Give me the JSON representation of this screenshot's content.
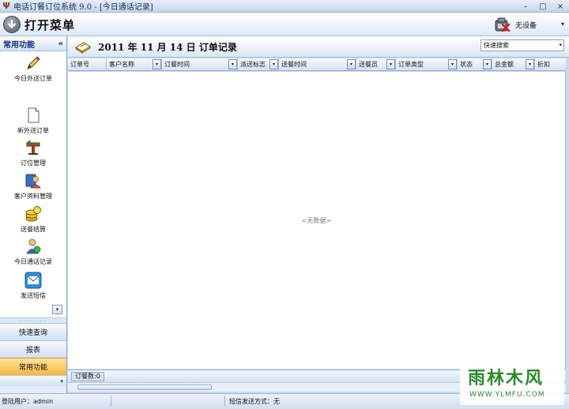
{
  "window": {
    "title": "电话订餐订位系统 9.0 - [今日通话记录]",
    "controls": [
      "–",
      "□",
      "×"
    ]
  },
  "header": {
    "open_menu_label": "打开菜单",
    "device_label": "无设备",
    "dropdown_glyph": "▾"
  },
  "sidebar": {
    "title": "常用功能",
    "collapse_glyph": "«",
    "items": [
      {
        "label": "今日外送订单",
        "icon": "pen-icon"
      },
      {
        "label": "新外送订单",
        "icon": "new-document-icon"
      },
      {
        "label": "订位管理",
        "icon": "table-reservation-icon"
      },
      {
        "label": "客户资料管理",
        "icon": "customers-icon"
      },
      {
        "label": "送餐结算",
        "icon": "coins-icon"
      },
      {
        "label": "今日通话记录",
        "icon": "phone-call-icon"
      },
      {
        "label": "发送短信",
        "icon": "mail-icon"
      }
    ],
    "scroll_glyph": "▾",
    "grip": "............",
    "tabs": [
      {
        "label": "快速查询",
        "active": false
      },
      {
        "label": "报表",
        "active": false
      },
      {
        "label": "常用功能",
        "active": true
      }
    ],
    "more_glyph": "▾"
  },
  "main": {
    "title": "2011 年 11 月 14 日 订单记录",
    "quick_search": {
      "value": "快速搜索",
      "arrow": "▾"
    },
    "columns": [
      {
        "label": "订单号",
        "dropdown": false
      },
      {
        "label": "客户名称",
        "dropdown": true
      },
      {
        "label": "订餐时间",
        "dropdown": true
      },
      {
        "label": "派送标志",
        "dropdown": true
      },
      {
        "label": "送餐时间",
        "dropdown": true
      },
      {
        "label": "送餐员",
        "dropdown": true
      },
      {
        "label": "订单类型",
        "dropdown": true
      },
      {
        "label": "状态",
        "dropdown": true
      },
      {
        "label": "总金额",
        "dropdown": true
      },
      {
        "label": "折扣",
        "dropdown": false
      }
    ],
    "empty_text": "<无数据>",
    "footer_count": "订餐数:0"
  },
  "status": {
    "user": "登陆用户：admin",
    "sms": "短信发送方式：无"
  },
  "watermark": {
    "logo": "雨林木风",
    "url": "WWW.YLMFU.COM"
  },
  "colors": {
    "accent_active_tab": "#f7b640",
    "panel_blue": "#c9d9ee",
    "watermark_green": "#2a8a2a"
  }
}
